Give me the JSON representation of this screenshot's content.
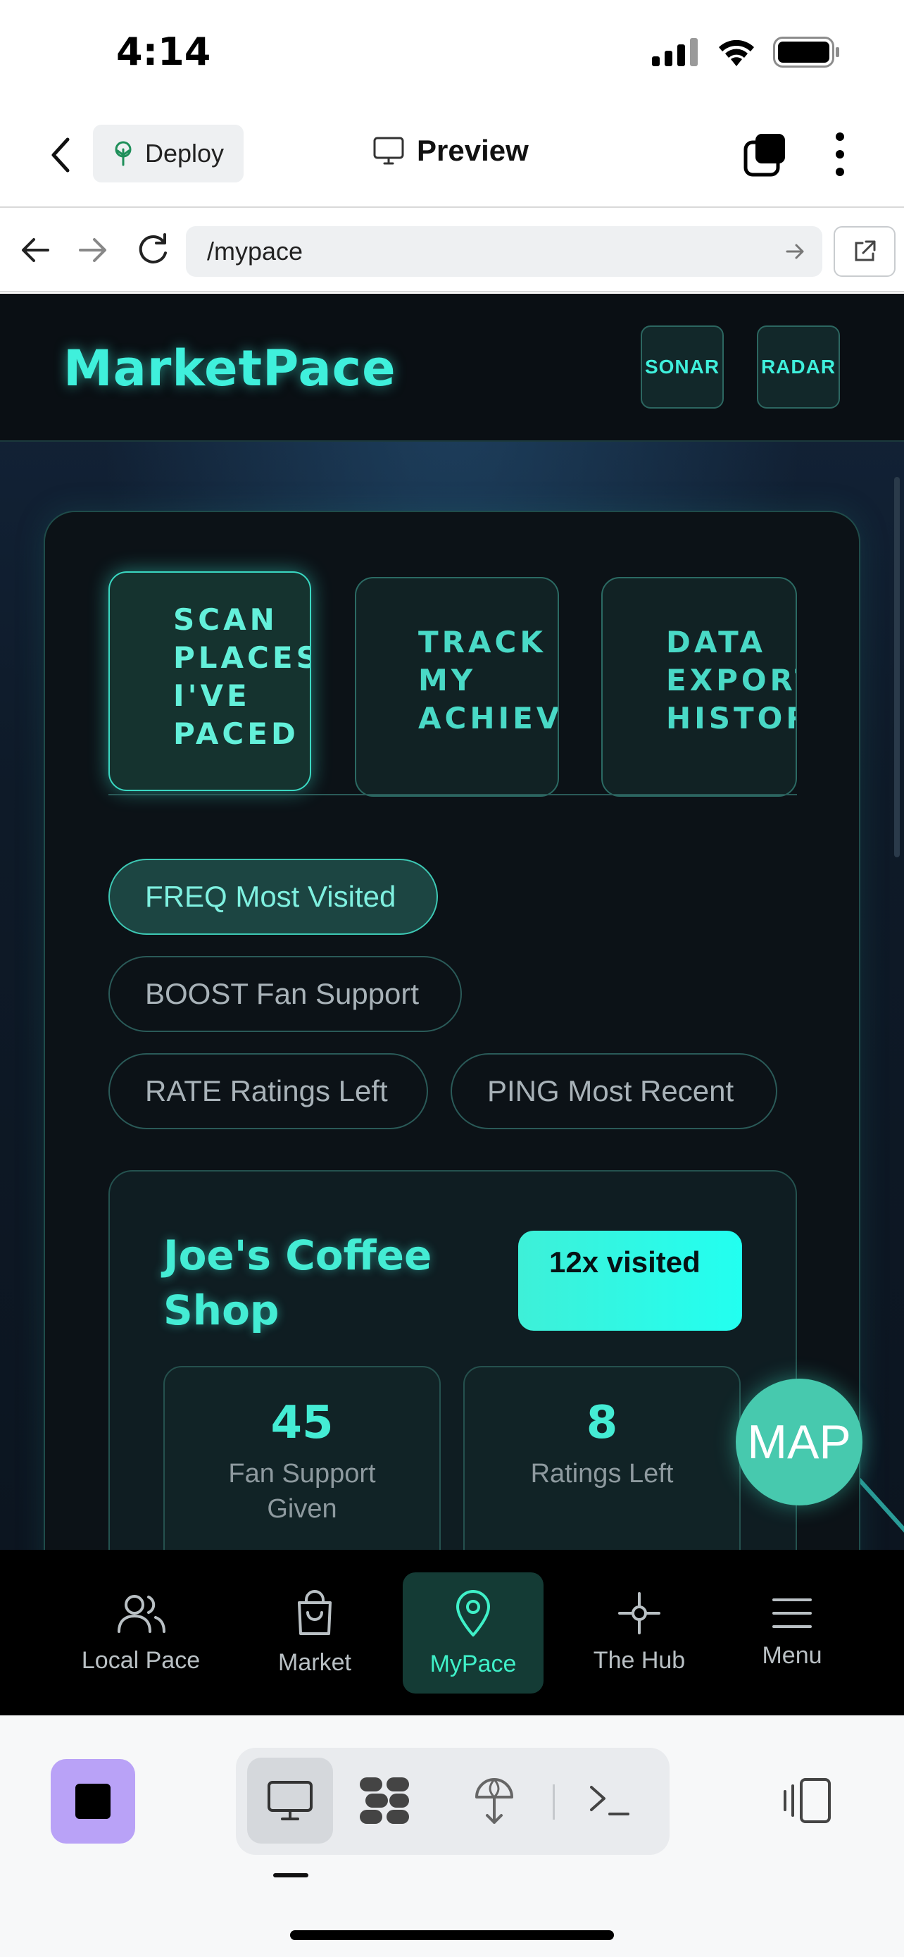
{
  "status_bar": {
    "time": "4:14"
  },
  "top_bar": {
    "deploy_label": "Deploy",
    "preview_label": "Preview"
  },
  "browser": {
    "url": "/mypace"
  },
  "app": {
    "brand": "MarketPace",
    "header_buttons": {
      "sonar": "SONAR",
      "radar": "RADAR"
    },
    "mode_tabs": [
      {
        "label": "SCAN\nPLACES\nI'VE\nPACED",
        "active": true
      },
      {
        "label": "TRACK\nMY\nACHIEVE",
        "active": false
      },
      {
        "label": "DATA\nEXPORT\nHISTOR",
        "active": false
      }
    ],
    "filters": [
      {
        "label": "FREQ Most Visited",
        "active": true
      },
      {
        "label": "BOOST Fan Support",
        "active": false
      },
      {
        "label": "RATE Ratings Left",
        "active": false
      },
      {
        "label": "PING Most Recent",
        "active": false
      }
    ],
    "place_card": {
      "name": "Joe's Coffee Shop",
      "badge": "12x visited",
      "stats": [
        {
          "value": "45",
          "label": "Fan Support Given"
        },
        {
          "value": "8",
          "label": "Ratings Left"
        }
      ]
    },
    "map_button": "MAP",
    "bottom_nav": [
      {
        "label": "Local Pace",
        "icon": "users-icon",
        "active": false
      },
      {
        "label": "Market",
        "icon": "shopping-bag-icon",
        "active": false
      },
      {
        "label": "MyPace",
        "icon": "map-pin-icon",
        "active": true
      },
      {
        "label": "The Hub",
        "icon": "hub-icon",
        "active": false
      },
      {
        "label": "Menu",
        "icon": "menu-icon",
        "active": false
      }
    ]
  },
  "colors": {
    "accent": "#3ff0dc",
    "app_background": "#0d1620",
    "active_nav_bg": "#143b35",
    "stop_button": "#b9a2f7"
  }
}
